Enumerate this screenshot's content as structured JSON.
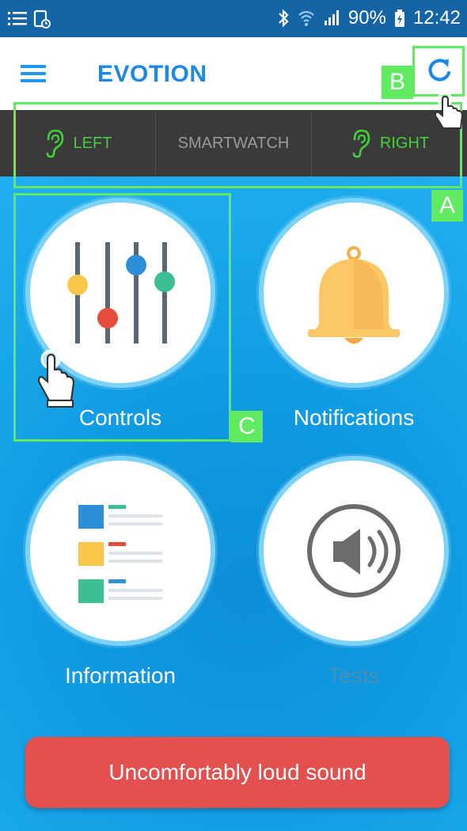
{
  "status_bar": {
    "battery_percent": "90%",
    "time": "12:42",
    "icons": [
      "list-icon",
      "screenshot-icon",
      "bluetooth-icon",
      "wifi-icon",
      "signal-icon",
      "battery-charging-icon"
    ]
  },
  "app_bar": {
    "title": "EVOTION",
    "menu_icon": "hamburger-menu-icon",
    "refresh_icon": "refresh-icon"
  },
  "device_tabs": [
    {
      "label": "LEFT",
      "icon": "ear-left-icon",
      "color": "#41d13b"
    },
    {
      "label": "SMARTWATCH",
      "color": "#9a9a9a"
    },
    {
      "label": "RIGHT",
      "icon": "ear-right-icon",
      "color": "#41d13b"
    }
  ],
  "tiles": [
    {
      "label": "Controls",
      "icon": "equalizer-sliders-icon"
    },
    {
      "label": "Notifications",
      "icon": "bell-icon"
    },
    {
      "label": "Information",
      "icon": "info-list-icon"
    },
    {
      "label": "Tests",
      "icon": "speaker-volume-icon"
    }
  ],
  "loud_sound_button": {
    "label": "Uncomfortably loud sound",
    "color": "#e25050"
  },
  "annotations": [
    {
      "letter": "A",
      "target": "device tabs"
    },
    {
      "letter": "B",
      "target": "refresh button"
    },
    {
      "letter": "C",
      "target": "controls tile"
    }
  ],
  "colors": {
    "accent_blue": "#1e88e5",
    "status_bar": "#1565a6",
    "tab_bar": "#3a3a3a",
    "annotation_green": "#5fea61",
    "main_blue": "#1a9fe4"
  }
}
